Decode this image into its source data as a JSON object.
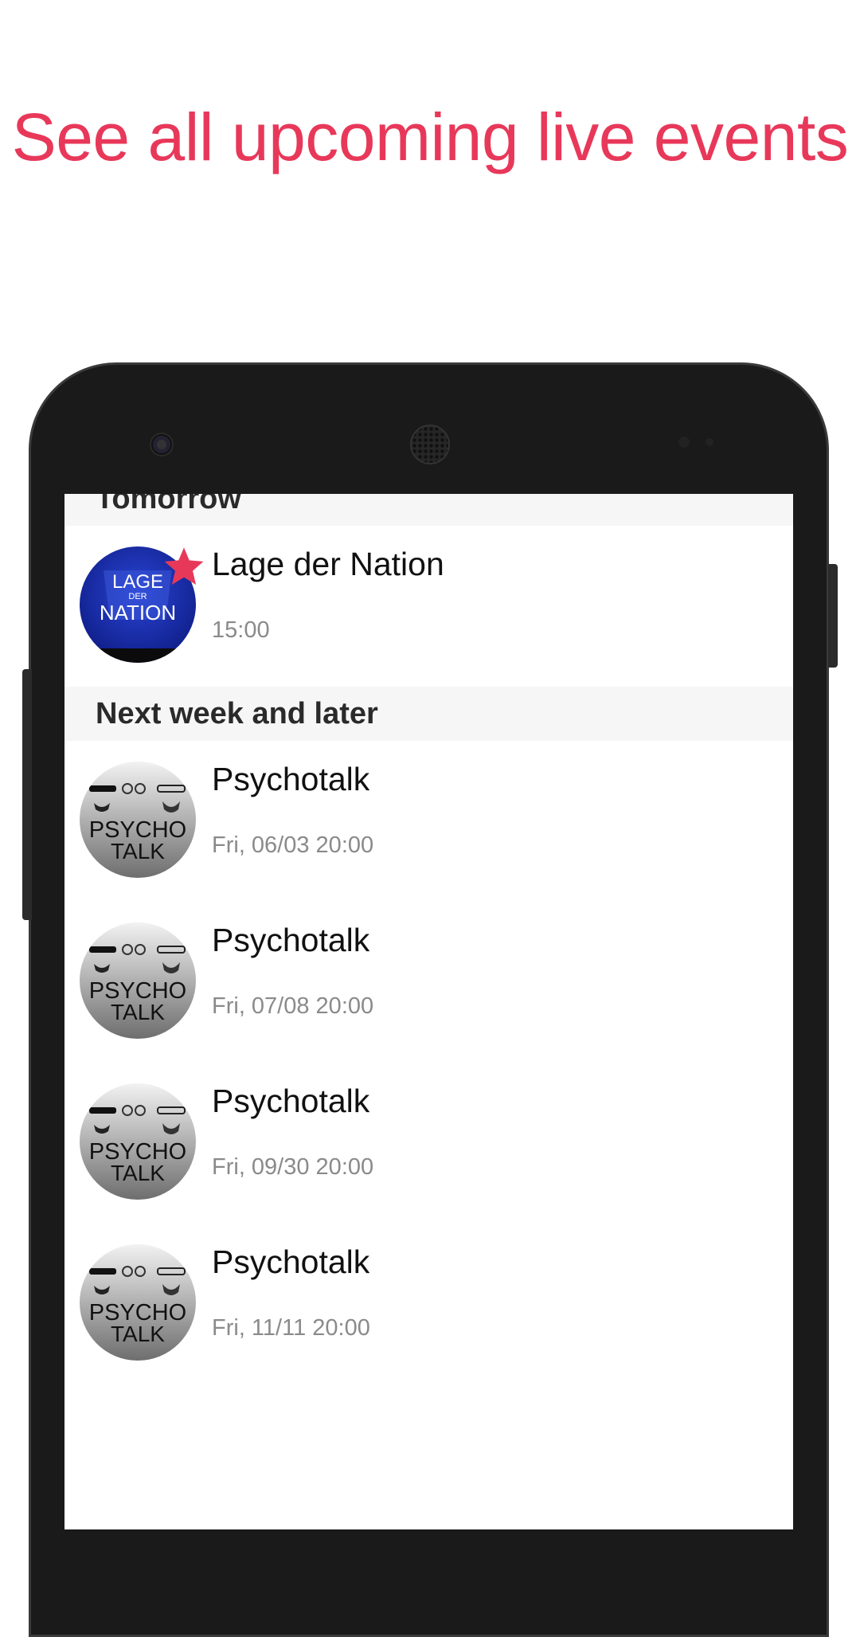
{
  "headline": "See all upcoming live events",
  "sections": [
    {
      "header": "Tomorrow",
      "events": [
        {
          "title": "Lage der Nation",
          "time": "15:00",
          "logo": {
            "line1": "LAGE",
            "line2": "DER",
            "line3": "NATION"
          },
          "favorite": true,
          "colors": {
            "logo_bg": "#1c2fb0",
            "star": "#e8385a"
          }
        }
      ]
    },
    {
      "header": "Next week and later",
      "events": [
        {
          "title": "Psychotalk",
          "time": "Fri, 06/03 20:00",
          "logo": {
            "line1": "PSYCHO",
            "line2": "TALK"
          }
        },
        {
          "title": "Psychotalk",
          "time": "Fri, 07/08 20:00",
          "logo": {
            "line1": "PSYCHO",
            "line2": "TALK"
          }
        },
        {
          "title": "Psychotalk",
          "time": "Fri, 09/30 20:00",
          "logo": {
            "line1": "PSYCHO",
            "line2": "TALK"
          }
        },
        {
          "title": "Psychotalk",
          "time": "Fri, 11/11 20:00",
          "logo": {
            "line1": "PSYCHO",
            "line2": "TALK"
          }
        }
      ]
    }
  ],
  "colors": {
    "accent": "#e8385a",
    "header_bg": "#f6f6f6"
  }
}
